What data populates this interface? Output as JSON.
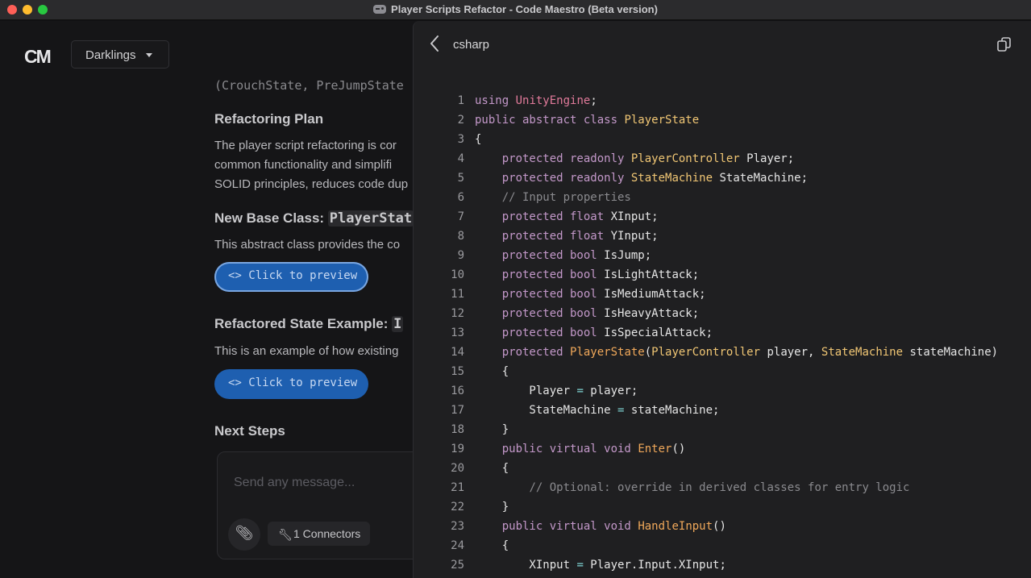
{
  "window": {
    "title": "Player Scripts Refactor - Code Maestro (Beta version)"
  },
  "sidebar": {
    "logo": "CM",
    "workspace": "Darklings"
  },
  "chat": {
    "clipped_code": "(CrouchState, PreJumpState",
    "section1_title": "Refactoring Plan",
    "section1_lines": [
      "The player script refactoring is cor",
      "common functionality and simplifi",
      "SOLID principles, reduces code dup"
    ],
    "section2_title_prefix": "New Base Class: ",
    "section2_title_code": "PlayerStat",
    "section2_text": "This abstract class provides the co",
    "preview_label": "<> Click to preview",
    "section3_title_prefix": "Refactored State Example: ",
    "section3_title_code": "I",
    "section3_text": "This is an example of how existing",
    "section4_title": "Next Steps",
    "composer_placeholder": "Send any message...",
    "connectors_label": "1 Connectors"
  },
  "code_panel": {
    "language": "csharp",
    "lines": [
      {
        "n": "1",
        "html": "<span class='kw'>using</span> <span class='fn' style='color:#e07a9a'>UnityEngine</span>;"
      },
      {
        "n": "2",
        "html": "<span class='kw'>public abstract class</span> <span class='ty'>PlayerState</span>"
      },
      {
        "n": "3",
        "html": "{"
      },
      {
        "n": "4",
        "html": "    <span class='kw'>protected readonly</span> <span class='ty'>PlayerController</span> Player;"
      },
      {
        "n": "5",
        "html": "    <span class='kw'>protected readonly</span> <span class='ty'>StateMachine</span> StateMachine;"
      },
      {
        "n": "6",
        "html": "    <span class='cm'>// Input properties</span>"
      },
      {
        "n": "7",
        "html": "    <span class='kw'>protected float</span> XInput;"
      },
      {
        "n": "8",
        "html": "    <span class='kw'>protected float</span> YInput;"
      },
      {
        "n": "9",
        "html": "    <span class='kw'>protected bool</span> IsJump;"
      },
      {
        "n": "10",
        "html": "    <span class='kw'>protected bool</span> IsLightAttack;"
      },
      {
        "n": "11",
        "html": "    <span class='kw'>protected bool</span> IsMediumAttack;"
      },
      {
        "n": "12",
        "html": "    <span class='kw'>protected bool</span> IsHeavyAttack;"
      },
      {
        "n": "13",
        "html": "    <span class='kw'>protected bool</span> IsSpecialAttack;"
      },
      {
        "n": "14",
        "html": "    <span class='kw'>protected</span> <span class='fn'>PlayerState</span>(<span class='ty'>PlayerController</span> player, <span class='ty'>StateMachine</span> stateMachine)"
      },
      {
        "n": "15",
        "html": "    {"
      },
      {
        "n": "16",
        "html": "        Player <span class='op'>=</span> player;"
      },
      {
        "n": "17",
        "html": "        StateMachine <span class='op'>=</span> stateMachine;"
      },
      {
        "n": "18",
        "html": "    }"
      },
      {
        "n": "19",
        "html": "    <span class='kw'>public virtual void</span> <span class='fn'>Enter</span>()"
      },
      {
        "n": "20",
        "html": "    {"
      },
      {
        "n": "21",
        "html": "        <span class='cm'>// Optional: override in derived classes for entry logic</span>"
      },
      {
        "n": "22",
        "html": "    }"
      },
      {
        "n": "23",
        "html": "    <span class='kw'>public virtual void</span> <span class='fn'>HandleInput</span>()"
      },
      {
        "n": "24",
        "html": "    {"
      },
      {
        "n": "25",
        "html": "        XInput <span class='op'>=</span> Player.Input.XInput;"
      }
    ]
  },
  "colors": {
    "accent": "#1e5fb0",
    "keyword": "#c398c9",
    "type": "#f0c674",
    "comment": "#8a8a8e"
  }
}
